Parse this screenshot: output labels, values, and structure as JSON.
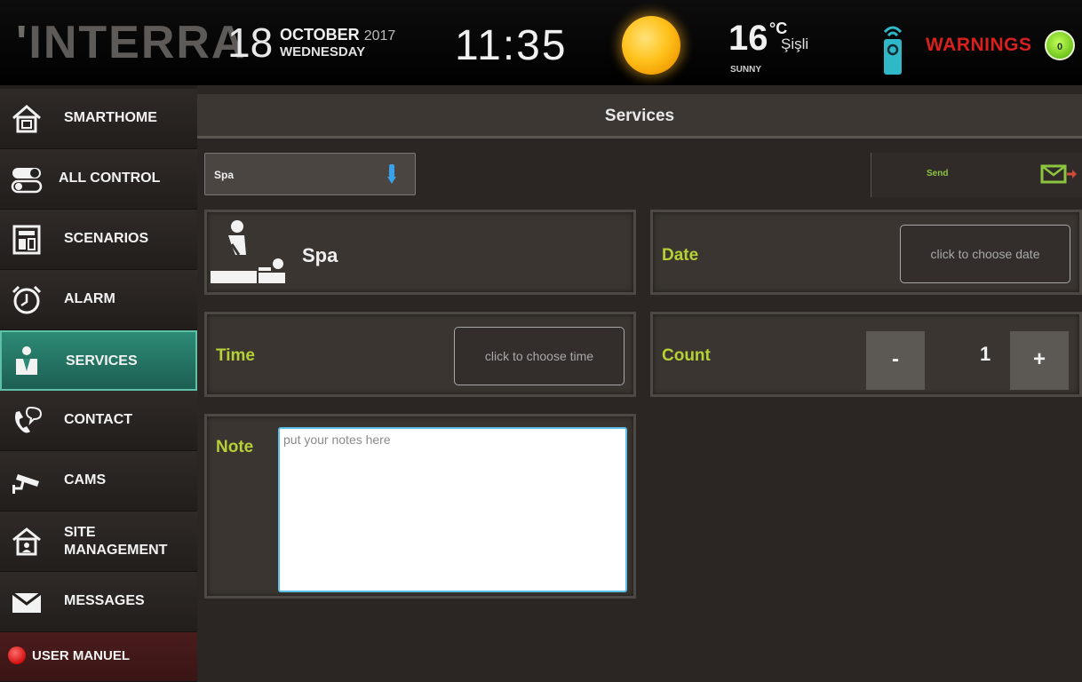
{
  "header": {
    "logo": "INTERRA",
    "day": "18",
    "month": "OCTOBER",
    "year": "2017",
    "weekday": "WEDNESDAY",
    "time": "11:35",
    "temperature": "16",
    "unit": "°C",
    "city": "Şişli",
    "condition": "SUNNY",
    "warnings_label": "WARNINGS",
    "warnings_count": "0",
    "weather_icon": "sun-icon",
    "remote_icon": "remote-control-icon"
  },
  "sidebar": {
    "items": [
      {
        "label": "SMARTHOME",
        "icon": "home-icon"
      },
      {
        "label": "ALL CONTROL",
        "icon": "toggle-icon"
      },
      {
        "label": "SCENARIOS",
        "icon": "scenario-panel-icon"
      },
      {
        "label": "ALARM",
        "icon": "alarm-clock-icon"
      },
      {
        "label": "SERVICES",
        "icon": "service-person-icon"
      },
      {
        "label": "CONTACT",
        "icon": "phone-chat-icon"
      },
      {
        "label": "CAMS",
        "icon": "security-camera-icon"
      },
      {
        "label": "SITE",
        "label2": "MANAGEMENT",
        "icon": "building-icon"
      },
      {
        "label": "MESSAGES",
        "icon": "envelope-icon"
      },
      {
        "label": "USER MANUEL",
        "icon": "red-dot-icon"
      }
    ],
    "active": "SERVICES"
  },
  "main": {
    "title": "Services",
    "service_select": {
      "value": "Spa"
    },
    "send": {
      "label": "Send",
      "icon": "send-mail-icon"
    },
    "service_panel": {
      "title": "Spa",
      "icon": "massage-icon"
    },
    "date": {
      "label": "Date",
      "button": "click to choose date"
    },
    "time": {
      "label": "Time",
      "button": "click to choose time"
    },
    "count": {
      "label": "Count",
      "minus": "-",
      "value": "1",
      "plus": "+"
    },
    "note": {
      "label": "Note",
      "placeholder": "put your notes here"
    }
  },
  "colors": {
    "accent_green": "#b6d035",
    "active_nav": "#2c8a75",
    "warning_red": "#d8201e",
    "badge_green": "#6fc41c"
  }
}
